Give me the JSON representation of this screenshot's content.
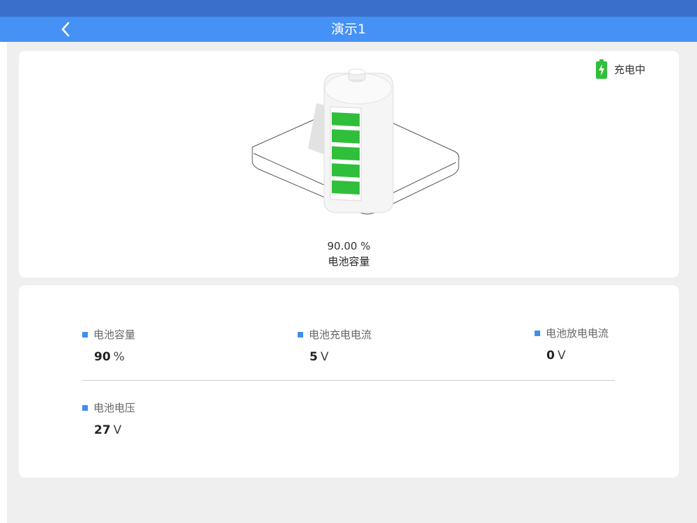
{
  "header": {
    "title": "演示1"
  },
  "status_card": {
    "charging_status": "充电中",
    "capacity_value": "90.00 %",
    "capacity_label": "电池容量",
    "battery_fill_fraction": 0.9,
    "accent_color": "#2fbf3a"
  },
  "metrics": [
    {
      "label": "电池容量",
      "value": "90",
      "unit": "%"
    },
    {
      "label": "电池充电电流",
      "value": "5",
      "unit": "V"
    },
    {
      "label": "电池放电电流",
      "value": "0",
      "unit": "V"
    },
    {
      "label": "电池电压",
      "value": "27",
      "unit": "V"
    }
  ],
  "colors": {
    "nav_bar": "#4591f5",
    "status_bar": "#3a6fcc",
    "bullet": "#3d8ef0",
    "background": "#efefef"
  }
}
